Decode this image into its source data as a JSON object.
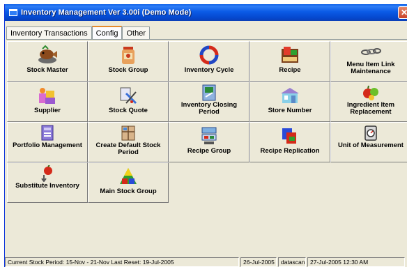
{
  "window": {
    "title": "Inventory Management Ver 3.00i (Demo Mode)",
    "close_glyph": "✕"
  },
  "tabs": [
    {
      "label": "Inventory Transactions",
      "active": false
    },
    {
      "label": "Config",
      "active": true
    },
    {
      "label": "Other",
      "active": false
    }
  ],
  "tiles": [
    {
      "label": "Stock Master",
      "icon": "fish-tray-icon"
    },
    {
      "label": "Stock Group",
      "icon": "jar-icon"
    },
    {
      "label": "Inventory Cycle",
      "icon": "cycle-arrows-icon"
    },
    {
      "label": "Recipe",
      "icon": "book-flag-icon"
    },
    {
      "label": "Menu Item Link Maintenance",
      "icon": "chain-link-icon"
    },
    {
      "label": "Supplier",
      "icon": "supplier-boxes-icon"
    },
    {
      "label": "Stock Quote",
      "icon": "quote-tools-icon"
    },
    {
      "label": "Inventory Closing Period",
      "icon": "closing-window-icon"
    },
    {
      "label": "Store Number",
      "icon": "store-building-icon"
    },
    {
      "label": "Ingredient Item Replacement",
      "icon": "fruit-icon"
    },
    {
      "label": "Portfolio Management",
      "icon": "portfolio-icon"
    },
    {
      "label": "Create Default Stock Period",
      "icon": "calendar-box-icon"
    },
    {
      "label": "Recipe Group",
      "icon": "recipe-group-icon"
    },
    {
      "label": "Recipe Replication",
      "icon": "replication-icon"
    },
    {
      "label": "Unit of Measurement",
      "icon": "scale-icon"
    },
    {
      "label": "Substitute Inventory",
      "icon": "apple-arrow-icon"
    },
    {
      "label": "Main Stock Group",
      "icon": "triangle-shapes-icon"
    }
  ],
  "status": {
    "stock_period": "Current Stock Period: 15-Nov - 21-Nov   Last Reset: 19-Jul-2005",
    "date": "26-Jul-2005",
    "user": "datascan",
    "datetime": "27-Jul-2005 12:30 AM"
  },
  "colors": {
    "titlebar": "#0b5be6",
    "active_tab_accent": "#e68b2c",
    "panel_bg": "#ece9d8"
  }
}
